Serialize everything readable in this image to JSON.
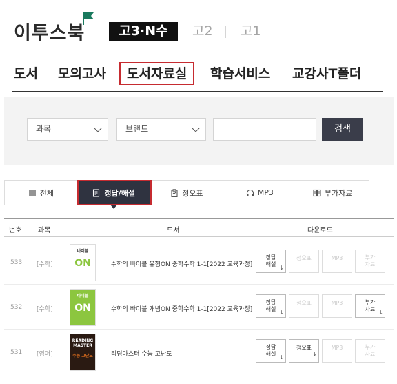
{
  "brand": {
    "logo_text": "이투스북"
  },
  "grade_tabs": [
    {
      "label": "고3·N수",
      "active": true
    },
    {
      "label": "고2"
    },
    {
      "label": "고1"
    }
  ],
  "nav": {
    "items": [
      "도서",
      "모의고사",
      "도서자료실",
      "학습서비스",
      "교강사T폴더"
    ],
    "active": "도서자료실"
  },
  "search": {
    "subject_select": "과목",
    "brand_select": "브랜드",
    "query": "",
    "button": "검색"
  },
  "category_tabs": [
    {
      "label": "전체",
      "icon": "list-icon"
    },
    {
      "label": "정답/해설",
      "icon": "document-icon",
      "active": true
    },
    {
      "label": "정오표",
      "icon": "clipboard-icon"
    },
    {
      "label": "MP3",
      "icon": "headphones-icon"
    },
    {
      "label": "부가자료",
      "icon": "book-icon"
    }
  ],
  "table": {
    "headers": [
      "번호",
      "과목",
      "도서",
      "다운로드"
    ],
    "rows": [
      {
        "num": "533",
        "subject": "[수학]",
        "title": "수학의 바이블 유형ON 중학수학 1-1[2022 교육과정]",
        "cover_color": "#ffffff",
        "cover_label": "바이블",
        "cover_sub": "ON",
        "accent": "#8cc63f",
        "downloads": [
          "정답\n해설",
          "정오표",
          "MP3",
          "부가\n자료"
        ],
        "enabled": [
          true,
          false,
          false,
          false
        ]
      },
      {
        "num": "532",
        "subject": "[수학]",
        "title": "수학의 바이블 개념ON 중학수학 1-1[2022 교육과정]",
        "cover_color": "#8cc63f",
        "cover_label": "바이블",
        "cover_sub": "ON",
        "accent": "#ffffff",
        "downloads": [
          "정답\n해설",
          "정오표",
          "MP3",
          "부가\n자료"
        ],
        "enabled": [
          true,
          false,
          false,
          true
        ]
      },
      {
        "num": "531",
        "subject": "[영어]",
        "title": "리딩마스터 수능 고난도",
        "cover_color": "#2a1a12",
        "cover_label": "READING MASTER",
        "cover_sub": "수능 고난도",
        "accent": "#e0701e",
        "downloads": [
          "정답\n해설",
          "정오표",
          "MP3",
          "부가\n자료"
        ],
        "enabled": [
          true,
          true,
          false,
          false
        ]
      }
    ]
  }
}
